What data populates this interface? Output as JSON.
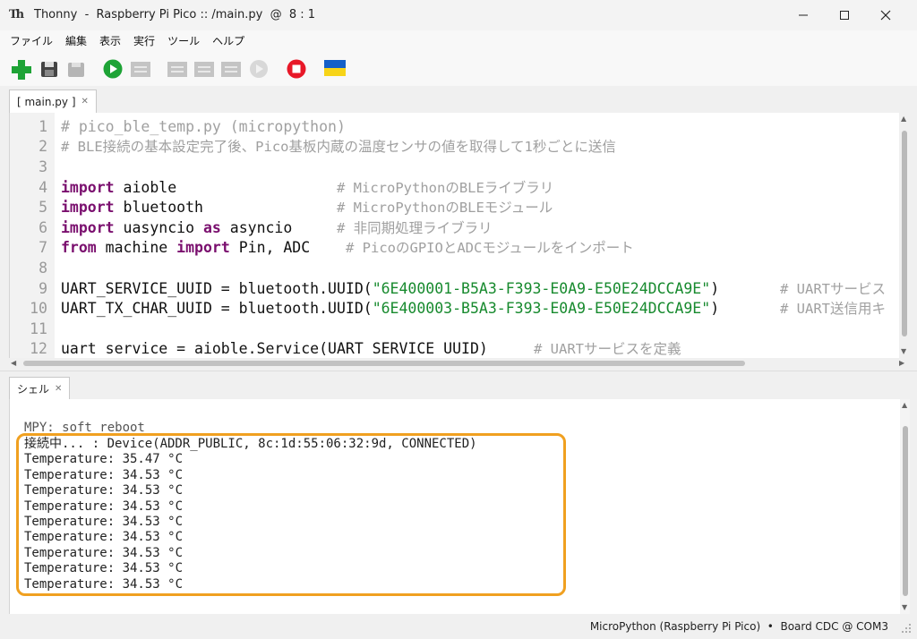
{
  "window": {
    "title": "Thonny  -  Raspberry Pi Pico :: /main.py  @  8 : 1",
    "app_icon_text": "Th"
  },
  "menu": [
    "ファイル",
    "編集",
    "表示",
    "実行",
    "ツール",
    "ヘルプ"
  ],
  "toolbar_icons": [
    "new-file-icon",
    "save-icon",
    "load-icon",
    "run-icon",
    "debug-icon",
    "step-over-icon",
    "step-into-icon",
    "step-out-icon",
    "resume-icon",
    "stop-icon",
    "ukraine-flag-icon"
  ],
  "colors": {
    "accent_green": "#1ea336",
    "stop_red": "#e81828",
    "keyword": "#7a0f6e",
    "comment": "#a0a0a0",
    "string": "#178a2e",
    "highlight_box": "#f0a020"
  },
  "editor": {
    "tab_label": "[ main.py ]",
    "tab_close": "✕",
    "line_numbers": [
      "1",
      "2",
      "3",
      "4",
      "5",
      "6",
      "7",
      "8",
      "9",
      "10",
      "11",
      "12"
    ],
    "lines": {
      "l1": "# pico_ble_temp.py (micropython)",
      "l2": "# BLE接続の基本設定完了後、Pico基板内蔵の温度センサの値を取得して1秒ごとに送信",
      "l4_kw": "import",
      "l4_code": " aioble",
      "l4_cm": "# MicroPythonのBLEライブラリ",
      "l5_kw": "import",
      "l5_code": " bluetooth",
      "l5_cm": "# MicroPythonのBLEモジュール",
      "l6_kw1": "import",
      "l6_code1": " uasyncio ",
      "l6_kw2": "as",
      "l6_code2": " asyncio",
      "l6_cm": "# 非同期処理ライブラリ",
      "l7_kw1": "from",
      "l7_code1": " machine ",
      "l7_kw2": "import",
      "l7_code2": " Pin, ADC",
      "l7_cm": "# PicoのGPIOとADCモジュールをインポート",
      "l9_code": "UART_SERVICE_UUID = bluetooth.UUID(",
      "l9_str": "\"6E400001-B5A3-F393-E0A9-E50E24DCCA9E\"",
      "l9_end": ")",
      "l9_cm": "# UARTサービス",
      "l10_code": "UART_TX_CHAR_UUID = bluetooth.UUID(",
      "l10_str": "\"6E400003-B5A3-F393-E0A9-E50E24DCCA9E\"",
      "l10_end": ")",
      "l10_cm": "# UART送信用キ",
      "l12_code": "uart service = aioble.Service(UART SERVICE UUID)",
      "l12_cm": "# UARTサービスを定義"
    }
  },
  "shell": {
    "tab_label": "シェル",
    "tab_close": "✕",
    "lines": [
      "MPY: soft reboot",
      "接続中... : Device(ADDR_PUBLIC, 8c:1d:55:06:32:9d, CONNECTED)",
      "Temperature: 35.47 °C",
      "Temperature: 34.53 °C",
      "Temperature: 34.53 °C",
      "Temperature: 34.53 °C",
      "Temperature: 34.53 °C",
      "Temperature: 34.53 °C",
      "Temperature: 34.53 °C",
      "Temperature: 34.53 °C",
      "Temperature: 34.53 °C"
    ]
  },
  "status": {
    "text": "MicroPython (Raspberry Pi Pico)  •  Board CDC @ COM3"
  }
}
